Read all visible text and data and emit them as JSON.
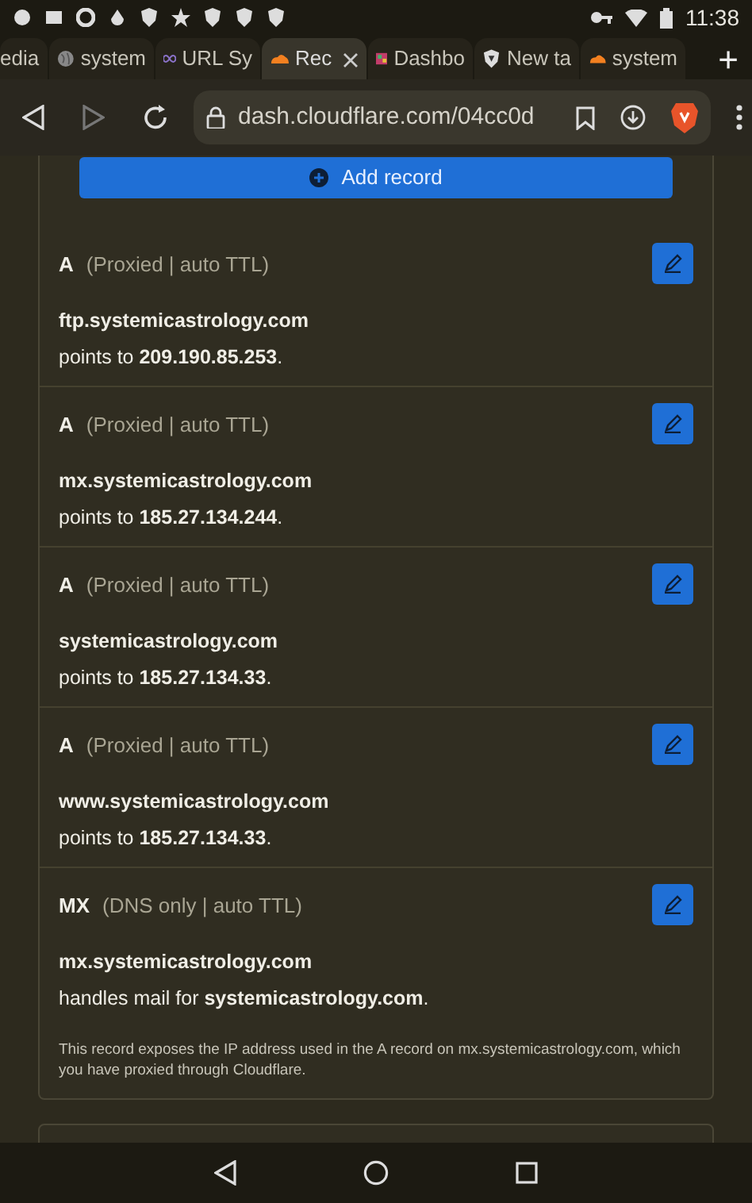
{
  "status_bar": {
    "time": "11:38"
  },
  "tabs": [
    {
      "label": "edia",
      "kind": "none",
      "selected": false
    },
    {
      "label": "system",
      "kind": "globe",
      "selected": false
    },
    {
      "label": "URL Sy",
      "kind": "infinity",
      "selected": false
    },
    {
      "label": "Rec",
      "kind": "cloud",
      "selected": true
    },
    {
      "label": "Dashbo",
      "kind": "tile",
      "selected": false
    },
    {
      "label": "New ta",
      "kind": "shield",
      "selected": false
    },
    {
      "label": "system",
      "kind": "cloud",
      "selected": false
    }
  ],
  "new_tab": "+",
  "address_bar": {
    "url": "dash.cloudflare.com/04cc0d"
  },
  "add_record": "Add record",
  "records": [
    {
      "type": "A",
      "mode": "(Proxied | auto TTL)",
      "host": "ftp.systemicastrology.com",
      "detail": "points to **209.190.85.253**."
    },
    {
      "type": "A",
      "mode": "(Proxied | auto TTL)",
      "host": "mx.systemicastrology.com",
      "detail": "points to **185.27.134.244**."
    },
    {
      "type": "A",
      "mode": "(Proxied | auto TTL)",
      "host": "systemicastrology.com",
      "detail": "points to **185.27.134.33**."
    },
    {
      "type": "A",
      "mode": "(Proxied | auto TTL)",
      "host": "www.systemicastrology.com",
      "detail": "points to **185.27.134.33**."
    },
    {
      "type": "MX",
      "mode": "(DNS only | auto TTL)",
      "host": "mx.systemicastrology.com",
      "detail": "handles mail for **systemicastrology.com**.",
      "note": "This record exposes the IP address used in the A record on mx.systemicastrology.com, which you have proxied through Cloudflare."
    }
  ]
}
